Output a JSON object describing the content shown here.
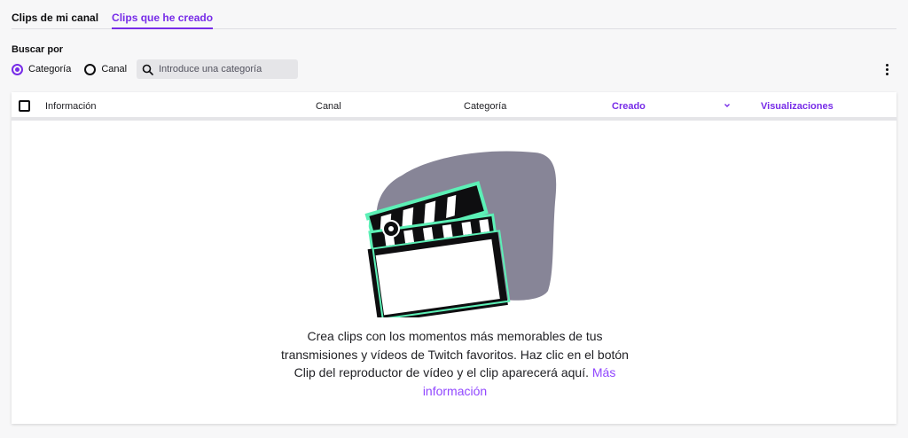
{
  "tabs": [
    {
      "label": "Clips de mi canal",
      "active": false
    },
    {
      "label": "Clips que he creado",
      "active": true
    }
  ],
  "filters": {
    "search_by_label": "Buscar por",
    "radio_options": [
      {
        "label": "Categoría",
        "checked": true
      },
      {
        "label": "Canal",
        "checked": false
      }
    ],
    "search_placeholder": "Introduce una categoría"
  },
  "table": {
    "columns": [
      {
        "label": "Información",
        "sorted": false
      },
      {
        "label": "Canal",
        "sorted": false
      },
      {
        "label": "Categoría",
        "sorted": false
      },
      {
        "label": "Creado",
        "sorted": true
      },
      {
        "label": "Visualizaciones",
        "sorted": false
      }
    ]
  },
  "empty_state": {
    "text": "Crea clips con los momentos más memorables de tus transmisiones y vídeos de Twitch favoritos. Haz clic en el botón Clip del reproductor de vídeo y el clip aparecerá aquí.",
    "link_label": "Más información"
  },
  "colors": {
    "accent": "#772ce8",
    "link": "#9147ff",
    "illustration_blob": "#878597",
    "illustration_outline": "#5cf0b6"
  },
  "icons": {
    "search": "search-icon",
    "more": "vertical-dots-icon",
    "sort": "chevron-down-icon",
    "illustration": "clapperboard-illustration"
  }
}
